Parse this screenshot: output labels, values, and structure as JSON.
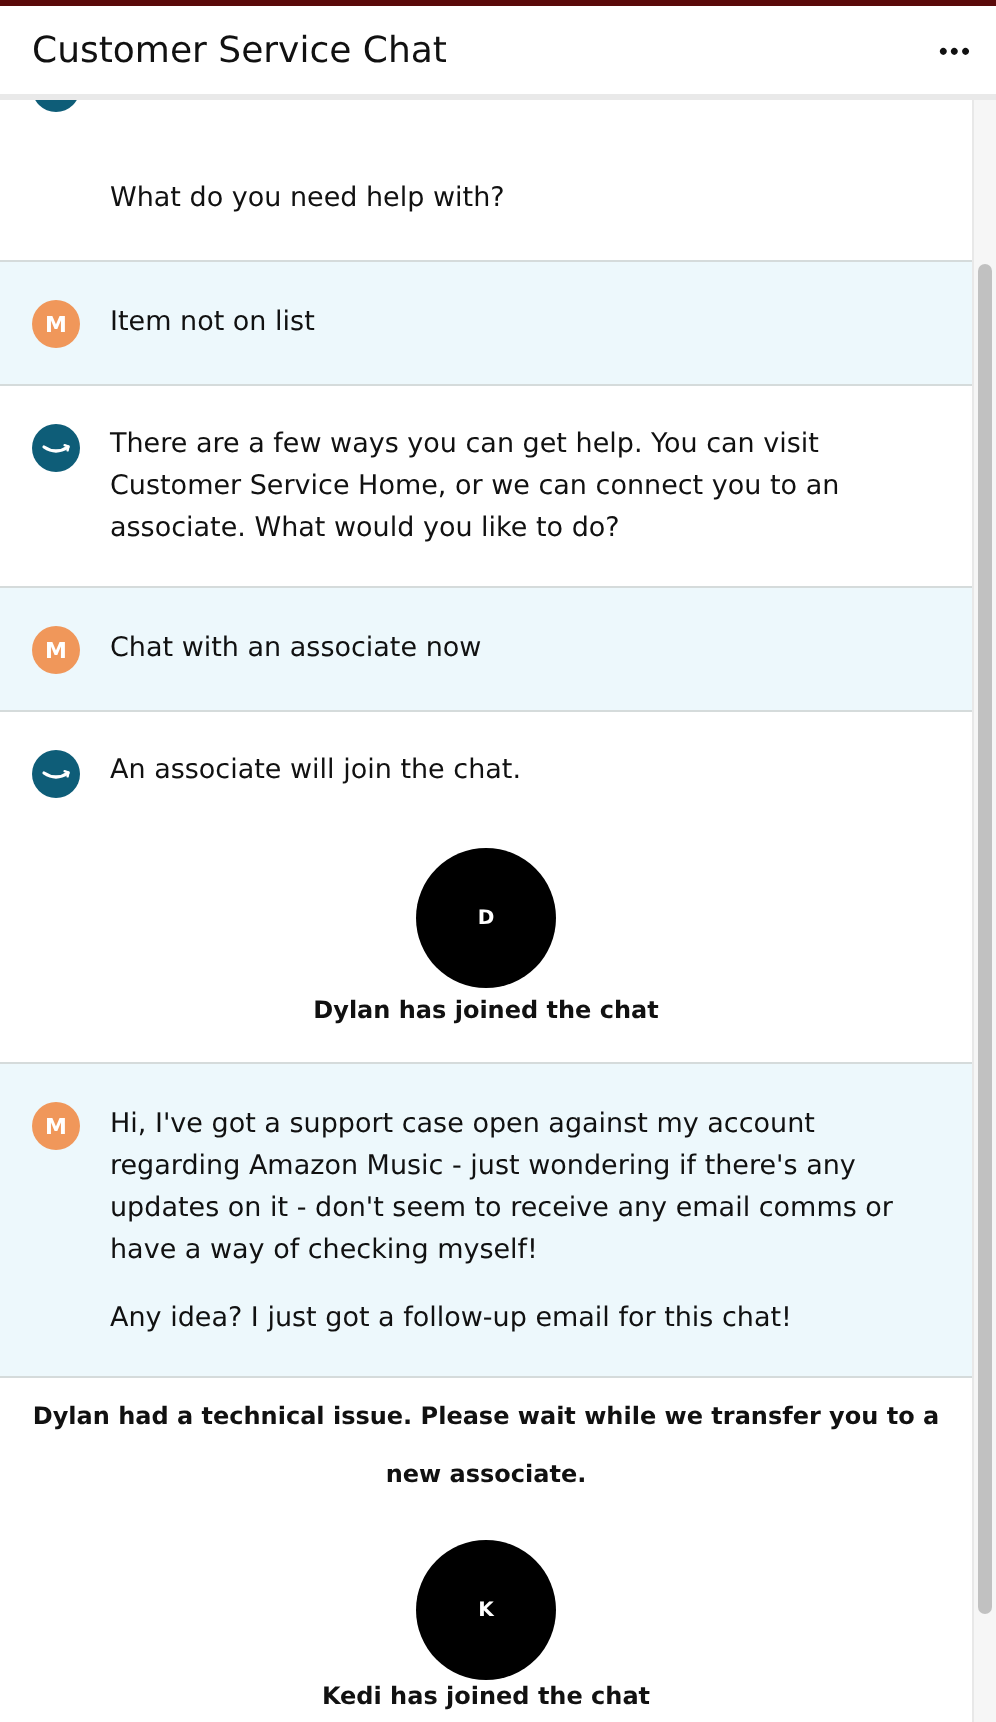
{
  "header": {
    "title": "Customer Service Chat",
    "menu": "•••"
  },
  "messages": [
    {
      "kind": "bot",
      "paragraphs": [
        "What do you need help with?"
      ]
    },
    {
      "kind": "user",
      "initial": "M",
      "paragraphs": [
        "Item not on list"
      ]
    },
    {
      "kind": "bot",
      "paragraphs": [
        "There are a few ways you can get help. You can visit Customer Service Home, or we can connect you to an associate. What would you like to do?"
      ]
    },
    {
      "kind": "user",
      "initial": "M",
      "paragraphs": [
        "Chat with an associate now"
      ]
    },
    {
      "kind": "bot",
      "paragraphs": [
        "An associate will join the chat."
      ]
    },
    {
      "kind": "join",
      "initial": "D",
      "text": "Dylan has joined the chat"
    },
    {
      "kind": "user",
      "initial": "M",
      "paragraphs": [
        "Hi, I've got a support case open against my account regarding Amazon Music - just wondering if there's any updates on it - don't seem to receive any email comms or have a way of checking myself!",
        "Any idea? I just got a follow-up email for this chat!"
      ]
    },
    {
      "kind": "system",
      "text": "Dylan had a technical issue. Please wait while we transfer you to a new associate."
    },
    {
      "kind": "join",
      "initial": "K",
      "text": "Kedi has joined the chat"
    }
  ]
}
